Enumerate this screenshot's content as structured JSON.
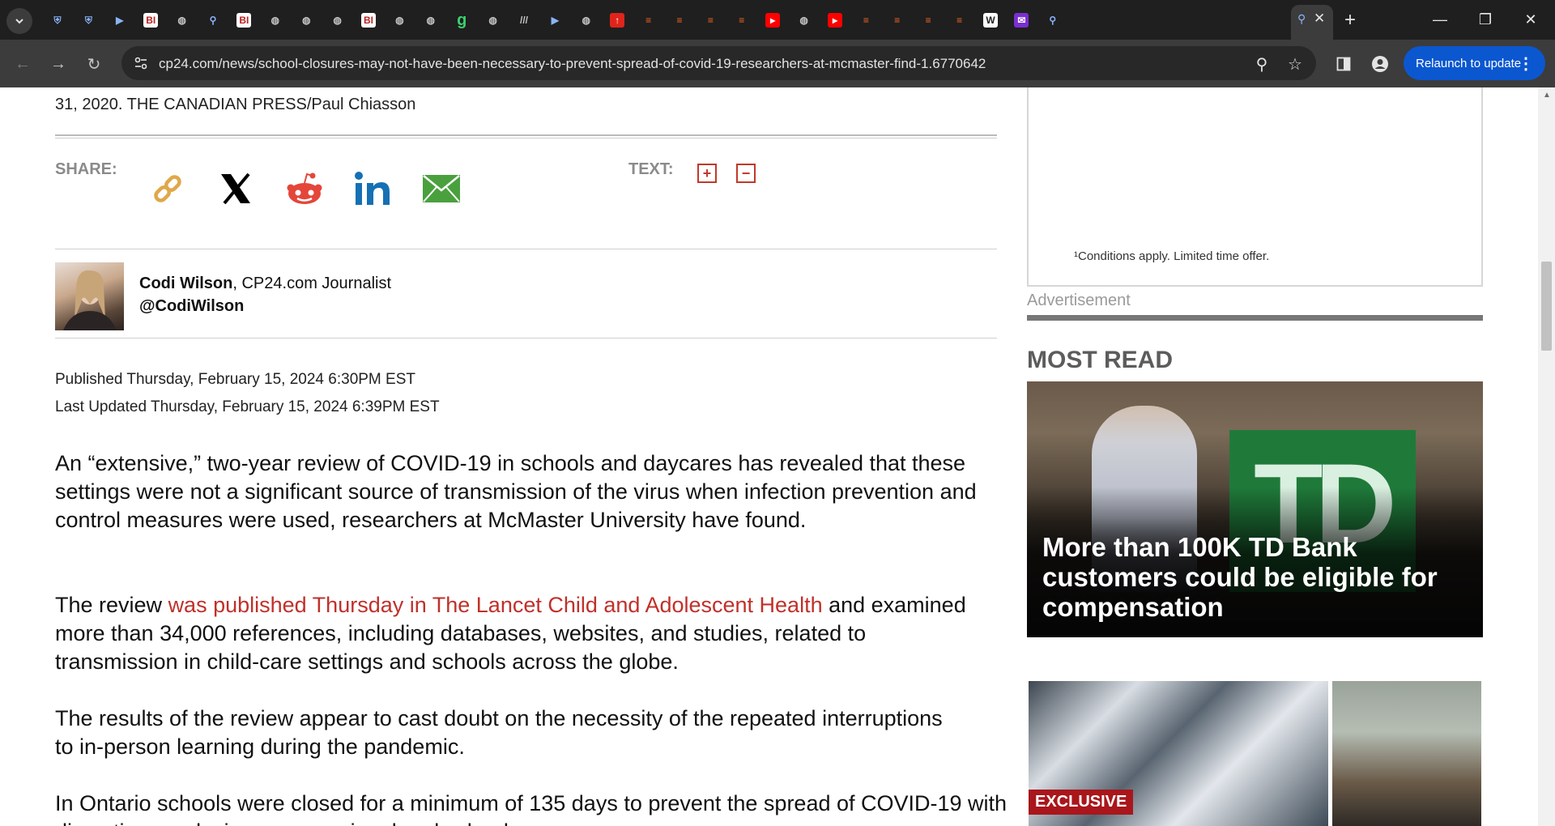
{
  "browser": {
    "tabs": [
      {
        "icon": "shield-icon"
      },
      {
        "icon": "shield-icon"
      },
      {
        "icon": "bookmark-icon"
      },
      {
        "icon": "bi-icon",
        "text": "BI"
      },
      {
        "icon": "globe-icon"
      },
      {
        "icon": "search-icon"
      },
      {
        "icon": "bi-icon",
        "text": "BI"
      },
      {
        "icon": "globe-icon"
      },
      {
        "icon": "globe-icon"
      },
      {
        "icon": "globe-icon"
      },
      {
        "icon": "bi-icon",
        "text": "BI"
      },
      {
        "icon": "globe-icon"
      },
      {
        "icon": "globe-icon"
      },
      {
        "icon": "g-icon",
        "text": "g"
      },
      {
        "icon": "globe-icon"
      },
      {
        "icon": "lines-icon"
      },
      {
        "icon": "bookmark-icon"
      },
      {
        "icon": "globe-icon"
      },
      {
        "icon": "red-icon"
      },
      {
        "icon": "orange-bookmark-icon"
      },
      {
        "icon": "orange-bookmark-icon"
      },
      {
        "icon": "orange-bookmark-icon"
      },
      {
        "icon": "orange-bookmark-icon"
      },
      {
        "icon": "youtube-icon"
      },
      {
        "icon": "globe-icon"
      },
      {
        "icon": "youtube-icon"
      },
      {
        "icon": "orange-bookmark-icon"
      },
      {
        "icon": "orange-bookmark-icon"
      },
      {
        "icon": "orange-bookmark-icon"
      },
      {
        "icon": "orange-bookmark-icon"
      },
      {
        "icon": "ww-icon"
      },
      {
        "icon": "mail-icon"
      },
      {
        "icon": "search-icon"
      }
    ],
    "url": "cp24.com/news/school-closures-may-not-have-been-necessary-to-prevent-spread-of-covid-19-researchers-at-mcmaster-find-1.6770642",
    "relaunch_label": "Relaunch to update"
  },
  "article": {
    "photo_caption": "31, 2020. THE CANADIAN PRESS/Paul Chiasson",
    "share_label": "SHARE:",
    "text_label": "TEXT:",
    "share_icons": [
      "link-icon",
      "x-icon",
      "reddit-icon",
      "linkedin-icon",
      "email-icon"
    ],
    "author": {
      "name": "Codi Wilson",
      "role": ", CP24.com Journalist",
      "handle": "@CodiWilson"
    },
    "published": "Published Thursday, February 15, 2024 6:30PM EST",
    "updated": "Last Updated Thursday, February 15, 2024 6:39PM EST",
    "p1": "An “extensive,” two-year review of COVID-19 in schools and daycares has revealed that these settings were not a significant source of transmission of the virus when infection prevention and control measures were used, researchers at McMaster University have found.",
    "p2_pre": "The review ",
    "p2_link": "was published Thursday in The Lancet Child and Adolescent Health",
    "p2_post": " and examined more than 34,000 references, including databases, websites, and studies, related to transmission in child-care settings and schools across the globe.",
    "p3": "The results of the review appear to cast doubt on the necessity of the repeated interruptions to in-person learning during the pandemic.",
    "p4": "In Ontario schools were closed for a minimum of 135 days to prevent the spread of COVID-19 with discretionary closings on a regional and school"
  },
  "sidebar": {
    "ad_note": "¹Conditions apply. Limited time offer.",
    "ad_label": "Advertisement",
    "most_read_title": "MOST READ",
    "story1_logo": "TD",
    "story1_headline": "More than 100K TD Bank customers could be eligible for compensation",
    "story2_badge": "EXCLUSIVE"
  },
  "colors": {
    "link": "#c0302a",
    "badge": "#a9161b",
    "relaunch": "#0b57d0"
  }
}
